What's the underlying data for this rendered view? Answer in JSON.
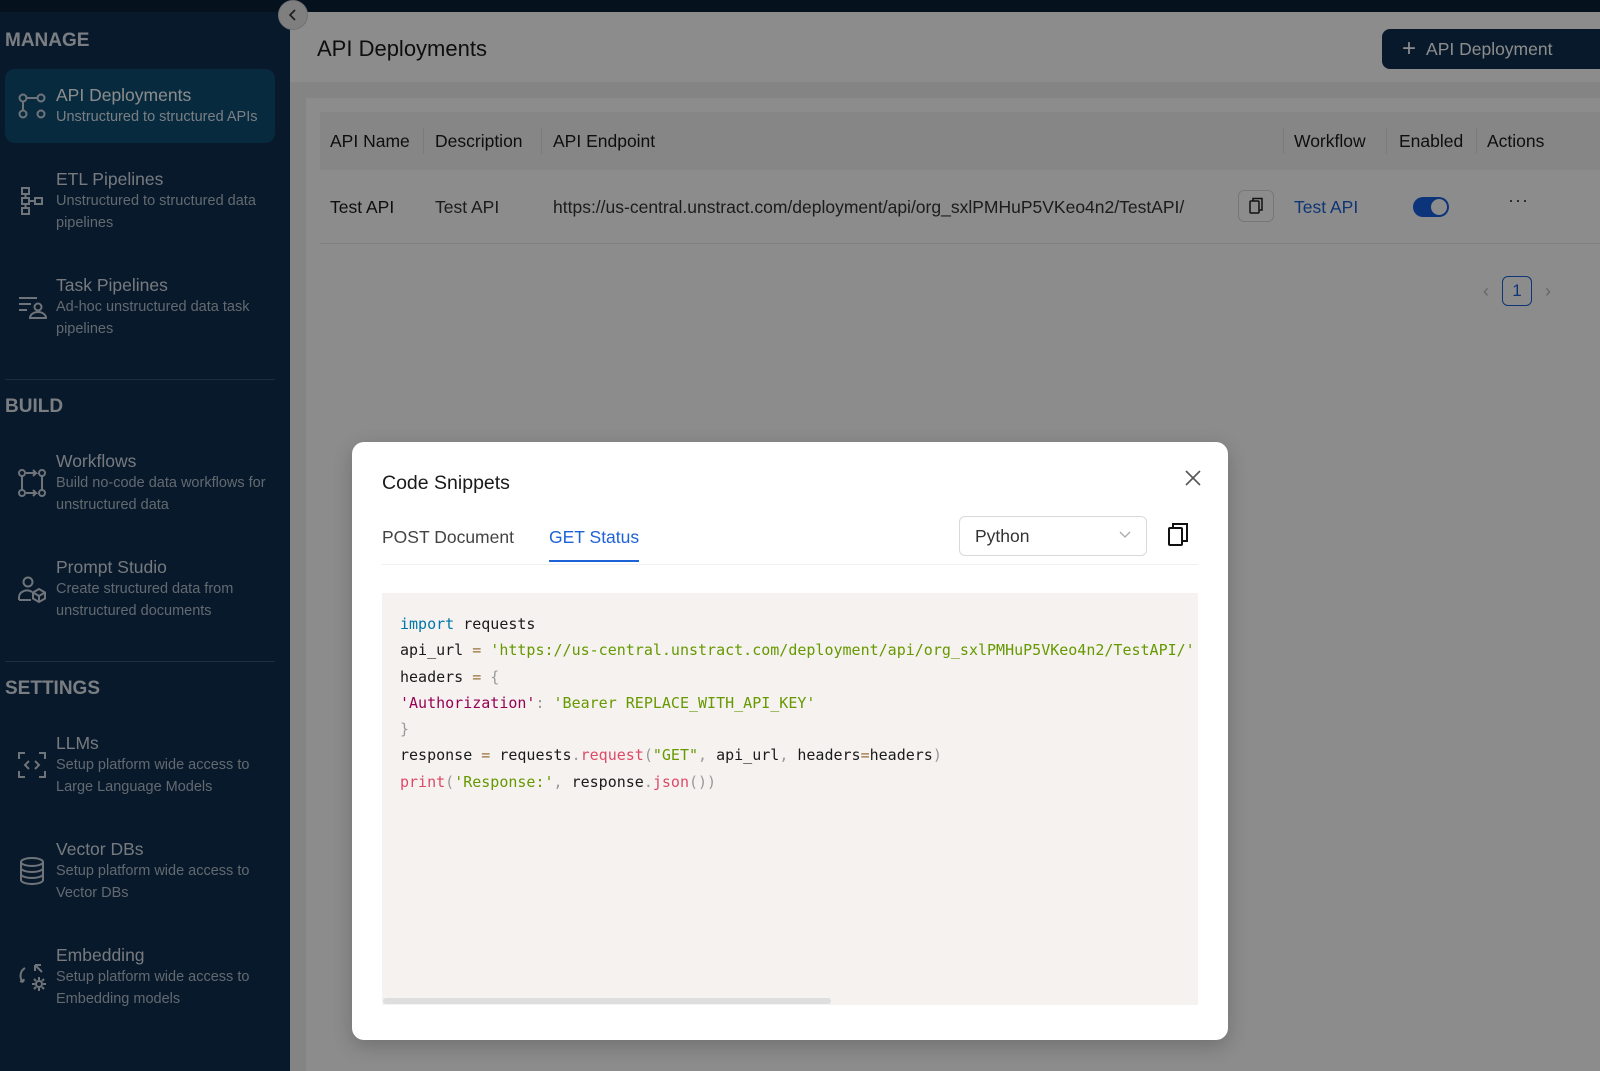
{
  "sidebar": {
    "sections": [
      {
        "title": "MANAGE"
      },
      {
        "title": "BUILD"
      },
      {
        "title": "SETTINGS"
      }
    ],
    "items": [
      {
        "label": "API Deployments",
        "desc1": "Unstructured to structured APIs",
        "desc2": "",
        "icon": "api-deployments-icon",
        "active": true
      },
      {
        "label": "ETL Pipelines",
        "desc1": "Unstructured to structured data",
        "desc2": "pipelines",
        "icon": "etl-pipelines-icon"
      },
      {
        "label": "Task Pipelines",
        "desc1": "Ad-hoc unstructured data task",
        "desc2": "pipelines",
        "icon": "task-pipelines-icon"
      },
      {
        "label": "Workflows",
        "desc1": "Build no-code data workflows for",
        "desc2": "unstructured data",
        "icon": "workflows-icon"
      },
      {
        "label": "Prompt Studio",
        "desc1": "Create structured data from",
        "desc2": "unstructured documents",
        "icon": "prompt-studio-icon"
      },
      {
        "label": "LLMs",
        "desc1": "Setup platform wide access to",
        "desc2": "Large Language Models",
        "icon": "llms-icon"
      },
      {
        "label": "Vector DBs",
        "desc1": "Setup platform wide access to",
        "desc2": "Vector DBs",
        "icon": "vector-dbs-icon"
      },
      {
        "label": "Embedding",
        "desc1": "Setup platform wide access to",
        "desc2": "Embedding models",
        "icon": "embedding-icon"
      }
    ]
  },
  "header": {
    "title": "API Deployments",
    "add_button": "API Deployment"
  },
  "table": {
    "columns": [
      "API Name",
      "Description",
      "API Endpoint",
      "Workflow",
      "Enabled",
      "Actions"
    ],
    "rows": [
      {
        "name": "Test API",
        "description": "Test API",
        "endpoint": "https://us-central.unstract.com/deployment/api/org_sxlPMHuP5VKeo4n2/TestAPI/",
        "workflow": "Test API",
        "enabled": true,
        "actions": "···"
      }
    ]
  },
  "pagination": {
    "current_page": "1"
  },
  "modal": {
    "title": "Code Snippets",
    "tabs": [
      {
        "label": "POST Document",
        "active": false
      },
      {
        "label": "GET Status",
        "active": true
      }
    ],
    "language": "Python",
    "code": {
      "l1_kw": "import",
      "l1_rest": " requests",
      "l2_var": "api_url ",
      "l2_op": "=",
      "l2_str": " 'https://us-central.unstract.com/deployment/api/org_sxlPMHuP5VKeo4n2/TestAPI/'",
      "l3_var": "headers ",
      "l3_op": "=",
      "l3_brace": " {",
      "l4_key": "'Authorization'",
      "l4_colon": ":",
      "l4_str": " 'Bearer REPLACE_WITH_API_KEY'",
      "l5_brace": "}",
      "l6_var": "response ",
      "l6_op": "=",
      "l6_obj": " requests",
      "l6_dot": ".",
      "l6_fn": "request",
      "l6_p1": "(",
      "l6_str": "\"GET\"",
      "l6_c1": ",",
      "l6_arg1": " api_url",
      "l6_c2": ",",
      "l6_arg2": " headers",
      "l6_eq": "=",
      "l6_arg3": "headers",
      "l6_p2": ")",
      "l7_fn": "print",
      "l7_p1": "(",
      "l7_str": "'Response:'",
      "l7_c1": ",",
      "l7_obj": " response",
      "l7_dot": ".",
      "l7_fn2": "json",
      "l7_p2": "())"
    }
  }
}
